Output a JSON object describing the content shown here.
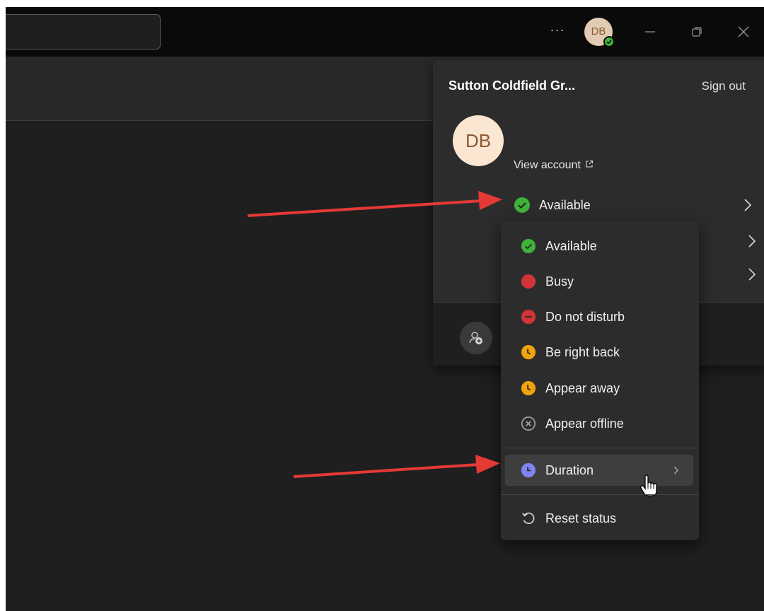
{
  "titlebar": {
    "more_label": "···",
    "avatar_initials": "DB"
  },
  "account": {
    "org_name": "Sutton Coldfield Gr...",
    "sign_out": "Sign out",
    "initials": "DB",
    "view_account": "View account",
    "current_status": "Available"
  },
  "status_menu": {
    "items": [
      {
        "label": "Available",
        "color": "#3fb23a"
      },
      {
        "label": "Busy",
        "color": "#d13438"
      },
      {
        "label": "Do not disturb",
        "color": "#d13438"
      },
      {
        "label": "Be right back",
        "color": "#f0a30a"
      },
      {
        "label": "Appear away",
        "color": "#f0a30a"
      },
      {
        "label": "Appear offline",
        "color": "#9a9a9a"
      }
    ],
    "duration": "Duration",
    "duration_color": "#7f85f5",
    "reset": "Reset status"
  },
  "annotation": {
    "arrow_color": "#e53935"
  }
}
